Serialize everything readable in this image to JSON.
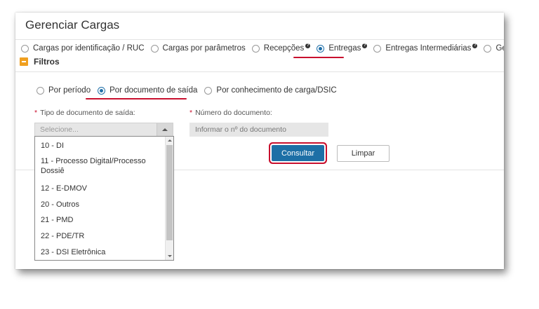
{
  "title": "Gerenciar Cargas",
  "tabs": [
    {
      "label": "Cargas por identificação / RUC",
      "checked": false,
      "help": false
    },
    {
      "label": "Cargas por parâmetros",
      "checked": false,
      "help": false
    },
    {
      "label": "Recepções",
      "checked": false,
      "help": true
    },
    {
      "label": "Entregas",
      "checked": true,
      "help": true
    },
    {
      "label": "Entregas Intermediárias",
      "checked": false,
      "help": true
    },
    {
      "label": "Gerar DSIC",
      "checked": false,
      "help": false
    }
  ],
  "help_glyph": "?",
  "filtros": {
    "label": "Filtros",
    "options": [
      {
        "label": "Por período",
        "checked": false
      },
      {
        "label": "Por documento de saída",
        "checked": true
      },
      {
        "label": "Por conhecimento de carga/DSIC",
        "checked": false
      }
    ]
  },
  "form": {
    "required_marker": "*",
    "tipo_label": "Tipo de documento de saída:",
    "tipo_placeholder": "Selecione...",
    "numero_label": "Número do documento:",
    "numero_placeholder": "Informar o nº do documento",
    "consultar_label": "Consultar",
    "limpar_label": "Limpar"
  },
  "dropdown_options": [
    "10 - DI",
    "11 - Processo Digital/Processo Dossiê",
    "12 - E-DMOV",
    "20 - Outros",
    "21 - PMD",
    "22 - PDE/TR",
    "23 - DSI Eletrônica"
  ],
  "colors": {
    "accent": "#1d6fa6",
    "highlight": "#c8102e",
    "collapse": "#f0a020"
  }
}
